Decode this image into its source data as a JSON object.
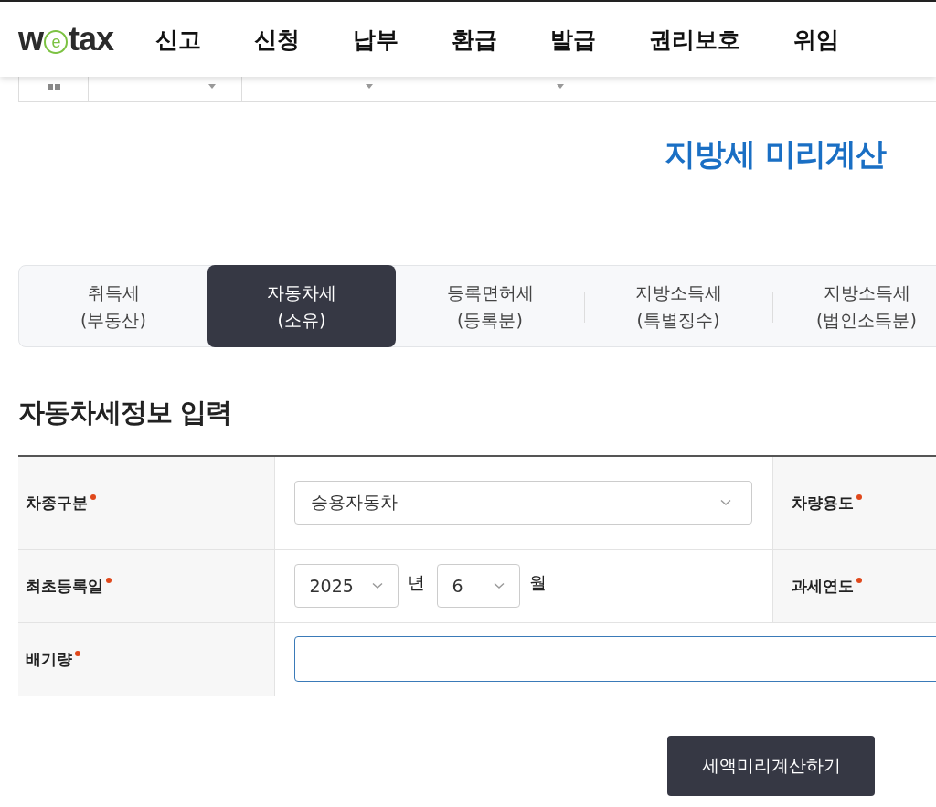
{
  "header": {
    "logo": [
      "w",
      "e",
      "tax"
    ],
    "nav": [
      {
        "label": "신고"
      },
      {
        "label": "신청"
      },
      {
        "label": "납부"
      },
      {
        "label": "환급"
      },
      {
        "label": "발급"
      },
      {
        "label": "권리보호"
      },
      {
        "label": "위임"
      }
    ]
  },
  "page_title": "지방세 미리계산",
  "tabs": [
    {
      "line1": "취득세",
      "line2": "(부동산)",
      "selected": false
    },
    {
      "line1": "자동차세",
      "line2": "(소유)",
      "selected": true
    },
    {
      "line1": "등록면허세",
      "line2": "(등록분)",
      "selected": false
    },
    {
      "line1": "지방소득세",
      "line2": "(특별징수)",
      "selected": false
    },
    {
      "line1": "지방소득세",
      "line2": "(법인소득분)",
      "selected": false
    }
  ],
  "section_title": "자동차세정보 입력",
  "form": {
    "rows": [
      {
        "kind": "select",
        "label": "차종구분",
        "required": true,
        "value": "승용자동차",
        "label2": "차량용도",
        "required2": true
      },
      {
        "kind": "date",
        "label": "최초등록일",
        "required": true,
        "year": "2025",
        "year_unit": "년",
        "month": "6",
        "month_unit": "월",
        "label2": "과세연도",
        "required2": true
      },
      {
        "kind": "input",
        "label": "배기량",
        "required": true,
        "focused": true
      }
    ]
  },
  "submit_button": "세액미리계산하기"
}
